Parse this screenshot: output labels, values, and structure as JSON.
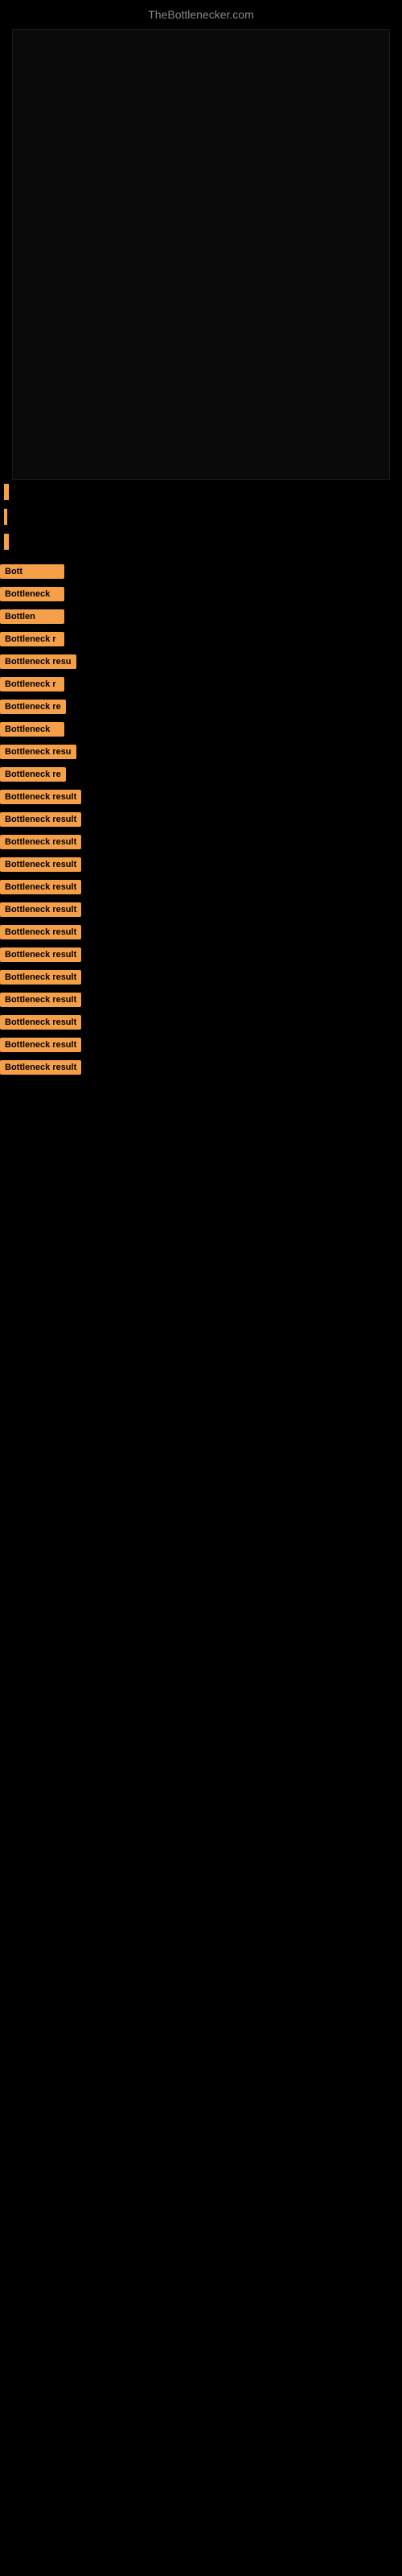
{
  "site": {
    "title": "TheBottlenecker.com"
  },
  "bottleneck_items": [
    {
      "id": 1,
      "label": "Bott",
      "width_class": "label-xs"
    },
    {
      "id": 2,
      "label": "Bottleneck",
      "width_class": "label-sm"
    },
    {
      "id": 3,
      "label": "Bottlen",
      "width_class": "label-sm"
    },
    {
      "id": 4,
      "label": "Bottleneck r",
      "width_class": "label-md"
    },
    {
      "id": 5,
      "label": "Bottleneck resu",
      "width_class": "label-lg"
    },
    {
      "id": 6,
      "label": "Bottleneck r",
      "width_class": "label-md"
    },
    {
      "id": 7,
      "label": "Bottleneck re",
      "width_class": "label-lg"
    },
    {
      "id": 8,
      "label": "Bottleneck",
      "width_class": "label-sm"
    },
    {
      "id": 9,
      "label": "Bottleneck resu",
      "width_class": "label-lg"
    },
    {
      "id": 10,
      "label": "Bottleneck re",
      "width_class": "label-lg"
    },
    {
      "id": 11,
      "label": "Bottleneck result",
      "width_class": "label-full"
    },
    {
      "id": 12,
      "label": "Bottleneck result",
      "width_class": "label-full"
    },
    {
      "id": 13,
      "label": "Bottleneck result",
      "width_class": "label-full"
    },
    {
      "id": 14,
      "label": "Bottleneck result",
      "width_class": "label-full"
    },
    {
      "id": 15,
      "label": "Bottleneck result",
      "width_class": "label-full"
    },
    {
      "id": 16,
      "label": "Bottleneck result",
      "width_class": "label-full"
    },
    {
      "id": 17,
      "label": "Bottleneck result",
      "width_class": "label-full"
    },
    {
      "id": 18,
      "label": "Bottleneck result",
      "width_class": "label-full"
    },
    {
      "id": 19,
      "label": "Bottleneck result",
      "width_class": "label-full"
    },
    {
      "id": 20,
      "label": "Bottleneck result",
      "width_class": "label-full"
    },
    {
      "id": 21,
      "label": "Bottleneck result",
      "width_class": "label-full"
    },
    {
      "id": 22,
      "label": "Bottleneck result",
      "width_class": "label-full"
    },
    {
      "id": 23,
      "label": "Bottleneck result",
      "width_class": "label-full"
    }
  ]
}
